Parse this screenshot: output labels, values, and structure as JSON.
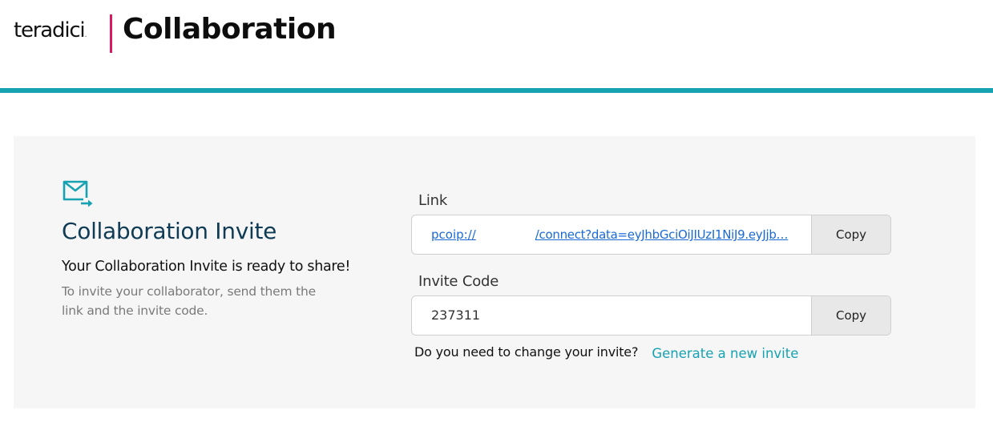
{
  "header": {
    "brand": "teradici",
    "brand_mark": ".",
    "title": "Collaboration"
  },
  "colors": {
    "accent": "#17a2b2",
    "brand_divider": "#d81b60",
    "heading": "#0f3b54",
    "link": "#1a6ad6"
  },
  "invite": {
    "title": "Collaboration Invite",
    "subtitle": "Your Collaboration Invite is ready to share!",
    "description": "To invite your collaborator, send them the link and the invite code.",
    "link_label": "Link",
    "link_prefix": "pcoip://",
    "link_suffix": "/connect?data=eyJhbGciOiJIUzI1NiJ9.eyJjb…",
    "code_label": "Invite Code",
    "code_value": "237311",
    "copy_label": "Copy",
    "change_question": "Do you need to change your invite?",
    "regenerate_label": "Generate a new invite"
  },
  "icons": {
    "invite_icon": "mail-send-icon"
  }
}
